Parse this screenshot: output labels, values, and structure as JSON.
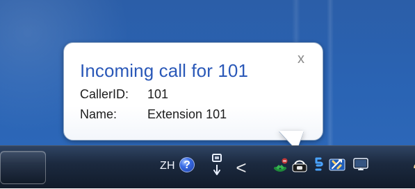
{
  "tray": {
    "language": "ZH",
    "help_symbol": "?",
    "overflow_symbol": "<",
    "right_edge_symbol": "♟"
  },
  "notification": {
    "title": "Incoming call for 101",
    "close_symbol": "x",
    "caller_id_label": "CallerID:",
    "caller_id_value": "101",
    "name_label": "Name:",
    "name_value": "Extension 101"
  },
  "colors": {
    "notification_title": "#2a58b8"
  },
  "icons": {
    "help": "help-icon",
    "overflow": "chevron-left-icon",
    "green_phone": "phone-green-icon",
    "handset": "phone-handset-icon",
    "sync": "sync-icon",
    "tools": "tools-icon",
    "monitor": "monitor-icon"
  }
}
